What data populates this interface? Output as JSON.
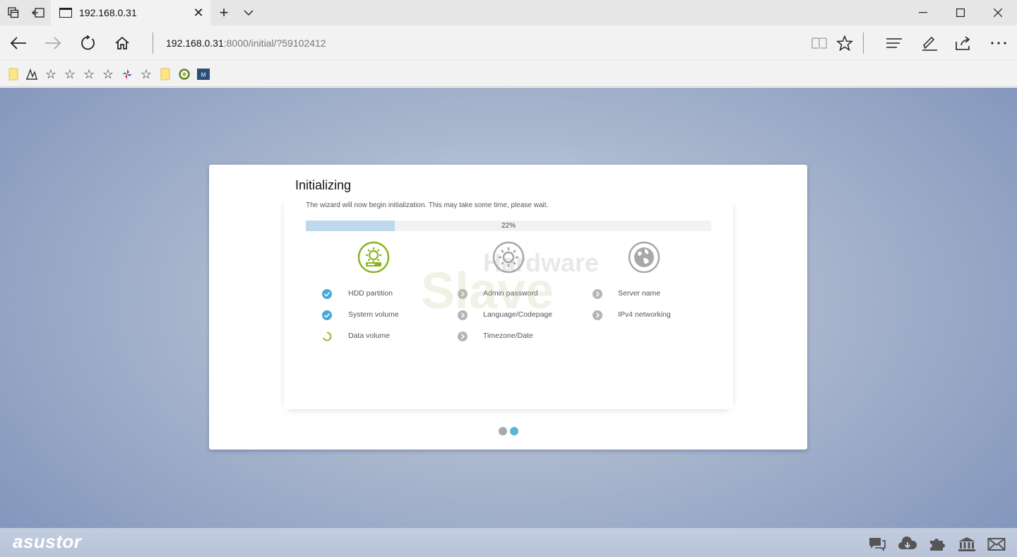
{
  "browser": {
    "tab_title": "192.168.0.31",
    "tab_close": "✕",
    "new_tab": "+",
    "address_host": "192.168.0.31",
    "address_rest": ":8000/initial/?59102412"
  },
  "wizard": {
    "title": "Initializing",
    "description": "The wizard will now begin initialization. This may take some time, please wait.",
    "progress_fraction": 0.22,
    "progress_label": "22%",
    "columns": [
      {
        "icon": "gear-drive-icon",
        "status": "active",
        "steps": [
          {
            "label": "HDD partition",
            "state": "done"
          },
          {
            "label": "System volume",
            "state": "done"
          },
          {
            "label": "Data volume",
            "state": "in-progress"
          }
        ]
      },
      {
        "icon": "gear-icon",
        "status": "pending",
        "steps": [
          {
            "label": "Admin password",
            "state": "pending"
          },
          {
            "label": "Language/Codepage",
            "state": "pending"
          },
          {
            "label": "Timezone/Date",
            "state": "pending"
          }
        ]
      },
      {
        "icon": "globe-icon",
        "status": "pending",
        "steps": [
          {
            "label": "Server name",
            "state": "pending"
          },
          {
            "label": "IPv4 networking",
            "state": "pending"
          }
        ]
      }
    ],
    "pager": {
      "current": 2,
      "total": 2
    }
  },
  "watermark": {
    "word1": "Hardware",
    "word2": "Slave"
  },
  "footer": {
    "brand": "asustor",
    "icons": [
      "chat-icon",
      "cloud-download-icon",
      "puzzle-icon",
      "bank-icon",
      "mail-icon"
    ]
  },
  "colors": {
    "accent_green": "#8ab41f",
    "check_blue": "#4aa8d8",
    "pending_gray": "#a8a8a8",
    "progress_fill": "#bed8ec"
  }
}
